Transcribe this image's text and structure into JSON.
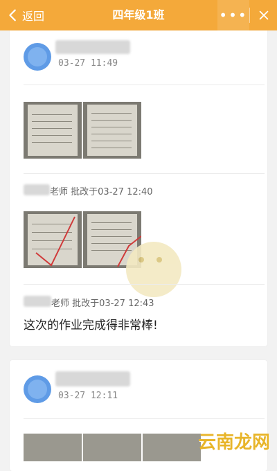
{
  "navbar": {
    "back_label": "返回",
    "title": "四年级1班",
    "more_label": "•••"
  },
  "post1": {
    "time": "03-27 11:49",
    "review1": {
      "teacher_suffix": "老师",
      "action": "批改于03-27 12:40"
    },
    "review2": {
      "teacher_suffix": "老师",
      "action": "批改于03-27 12:43",
      "comment": "这次的作业完成得非常棒!"
    }
  },
  "post2": {
    "time": "03-27 12:11"
  },
  "watermark": "云南龙网",
  "colors": {
    "navbar": "#f4a93a",
    "avatar": "#5f9be6",
    "watermark": "#e8b52a"
  }
}
